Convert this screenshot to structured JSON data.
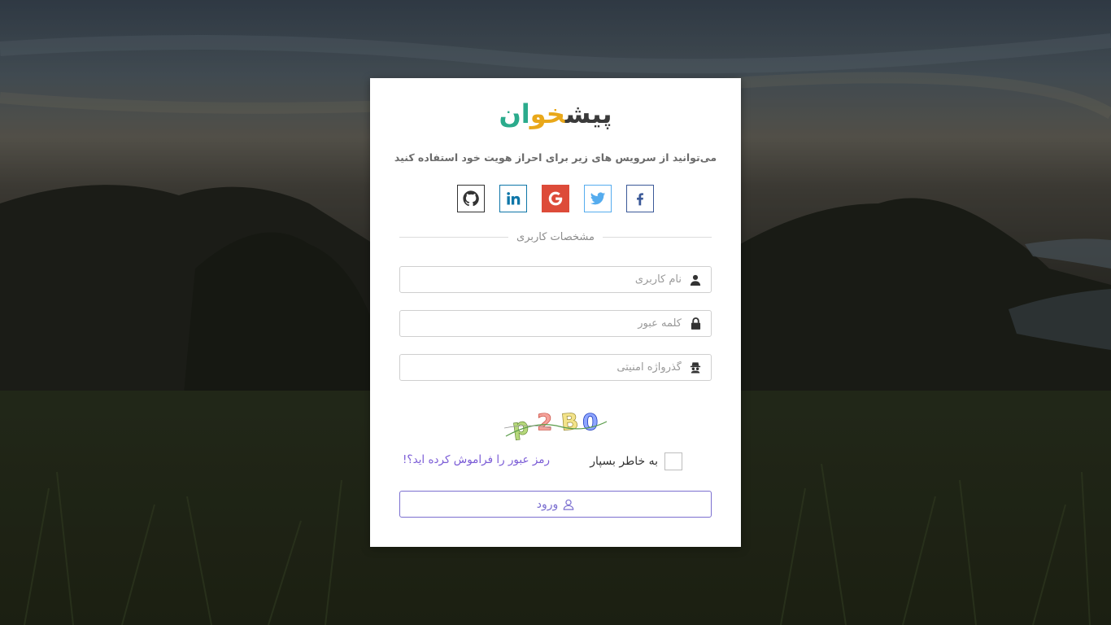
{
  "logo": {
    "part1": "پیش",
    "part2": "خو",
    "part3": "ان"
  },
  "social_section": {
    "heading": "می‌توانید از سرویس های زیر برای احراز هویت خود استفاده کنید",
    "buttons": [
      {
        "name": "github",
        "icon": "github-icon",
        "color": "#333333"
      },
      {
        "name": "linkedin",
        "icon": "linkedin-icon",
        "color": "#0e76a8"
      },
      {
        "name": "google",
        "icon": "google-icon",
        "color": "#dd4b39"
      },
      {
        "name": "twitter",
        "icon": "twitter-icon",
        "color": "#55acee"
      },
      {
        "name": "facebook",
        "icon": "facebook-icon",
        "color": "#3b5998"
      }
    ]
  },
  "user_section": {
    "heading": "مشخصات کاربری"
  },
  "form": {
    "username": {
      "placeholder": "نام کاربری",
      "value": "",
      "icon": "user-icon"
    },
    "password": {
      "placeholder": "کلمه عبور",
      "value": "",
      "icon": "lock-icon"
    },
    "security_code": {
      "placeholder": "گذرواژه امنیتی",
      "value": "",
      "icon": "spy-icon"
    },
    "captcha_text": "p2B0",
    "remember_me": {
      "label": "به خاطر بسپار",
      "checked": false
    },
    "forgot_password": "رمز عبور را فراموش کرده اید؟!",
    "login_button": "ورود"
  },
  "colors": {
    "accent": "#7b6fd0",
    "link": "#7b5cd6",
    "logo_dark": "#3a3a3a",
    "logo_yellow": "#e9a81a",
    "logo_green": "#2bab8c"
  }
}
